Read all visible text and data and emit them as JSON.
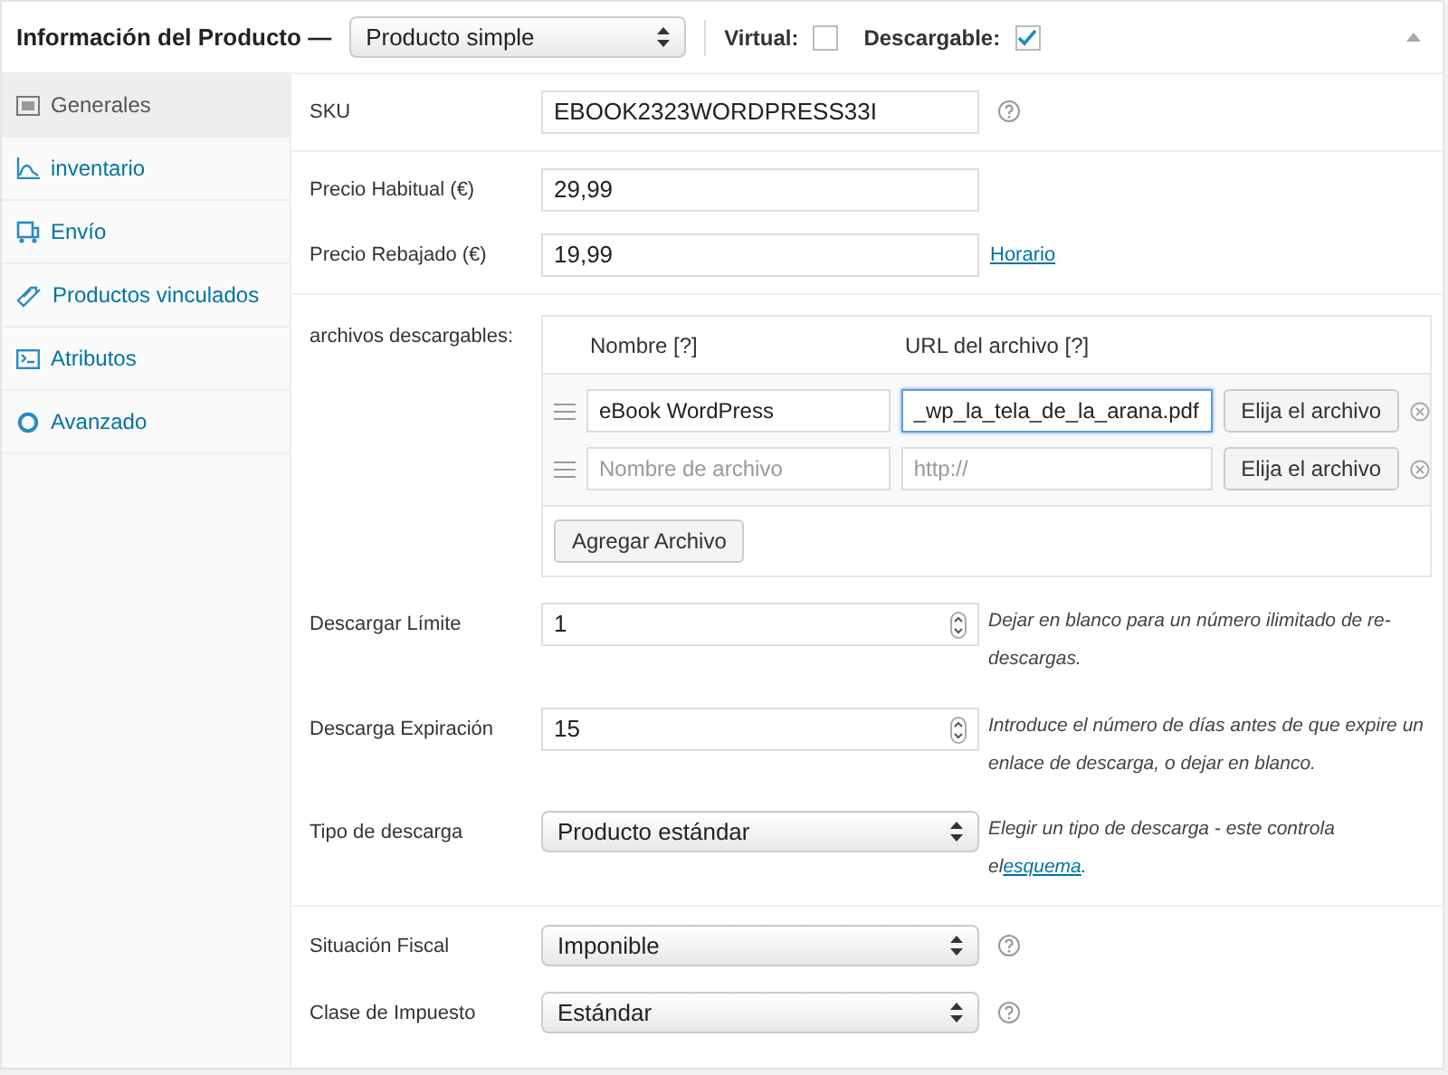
{
  "header": {
    "title": "Información del Producto —",
    "product_type": "Producto simple",
    "checkboxes": [
      {
        "label": "Virtual:",
        "checked": false
      },
      {
        "label": "Descargable:",
        "checked": true
      }
    ]
  },
  "sidebar": {
    "items": [
      {
        "label": "Generales",
        "selected": true
      },
      {
        "label": "inventario",
        "selected": false
      },
      {
        "label": "Envío",
        "selected": false
      },
      {
        "label": "Productos vinculados",
        "selected": false
      },
      {
        "label": "Atributos",
        "selected": false
      },
      {
        "label": "Avanzado",
        "selected": false
      }
    ]
  },
  "sections": [
    {
      "rows": [
        {
          "kind": "text",
          "label": "SKU",
          "value": "EBOOK2323WORDPRESS33I",
          "help": true
        }
      ]
    },
    {
      "rows": [
        {
          "kind": "text",
          "label": "Precio Habitual (€)",
          "value": "29,99",
          "help": false
        },
        {
          "kind": "text",
          "label": "Precio Rebajado (€)",
          "value": "19,99",
          "help": false,
          "link": "Horario"
        }
      ]
    },
    {
      "rows": [
        {
          "kind": "files",
          "label": "archivos descargables:",
          "columns": [
            "Nombre [?]",
            "URL del archivo [?]"
          ],
          "files": [
            {
              "name": {
                "value": "eBook WordPress"
              },
              "url": {
                "value": "_wp_la_tela_de_la_arana.pdf",
                "focused": true
              },
              "choose": "Elija el archivo"
            },
            {
              "name": {
                "placeholder": "Nombre de archivo"
              },
              "url": {
                "placeholder": "http://",
                "focused": false
              },
              "choose": "Elija el archivo"
            }
          ],
          "add": "Agregar Archivo"
        },
        {
          "kind": "number",
          "label": "Descargar Límite",
          "value": "1",
          "hint": {
            "text": "Dejar en blanco para un número ilimitado de re-descargas."
          }
        },
        {
          "kind": "number",
          "label": "Descarga Expiración",
          "value": "15",
          "hint": {
            "text": "Introduce el número de días antes de que expire un enlace de descarga, o dejar en blanco."
          }
        },
        {
          "kind": "select",
          "label": "Tipo de descarga",
          "value": "Producto estándar",
          "hint": {
            "text": "Elegir un tipo de descarga - este controla el",
            "link": "esquema",
            "tail": "."
          }
        }
      ]
    },
    {
      "rows": [
        {
          "kind": "select",
          "label": "Situación Fiscal",
          "value": "Imponible",
          "help": true
        },
        {
          "kind": "select",
          "label": "Clase de Impuesto",
          "value": "Estándar",
          "help": true
        }
      ]
    }
  ]
}
